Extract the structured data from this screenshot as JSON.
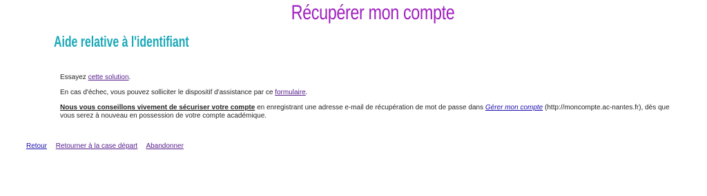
{
  "header": {
    "title": "Récupérer mon compte",
    "subtitle": "Aide relative à l'identifiant"
  },
  "content": {
    "line1_prefix": "Essayez ",
    "line1_link": "cette solution",
    "line1_suffix": ".",
    "line2_prefix": "En cas d'échec, vous pouvez solliciter le dispositif d'assistance par ce ",
    "line2_link": "formulaire",
    "line2_suffix": ".",
    "line3_strong": "Nous vous conseillons vivement de sécuriser votre compte",
    "line3_middle": " en enregistrant une adresse e-mail de récupération de mot de passe dans ",
    "line3_link": "Gérer mon compte",
    "line3_suffix": " (http://moncompte.ac-nantes.fr), dès que vous serez à nouveau en possession de votre compte académique."
  },
  "nav": {
    "back": "Retour",
    "restart": "Retourner à la case départ",
    "abandon": "Abandonner"
  }
}
